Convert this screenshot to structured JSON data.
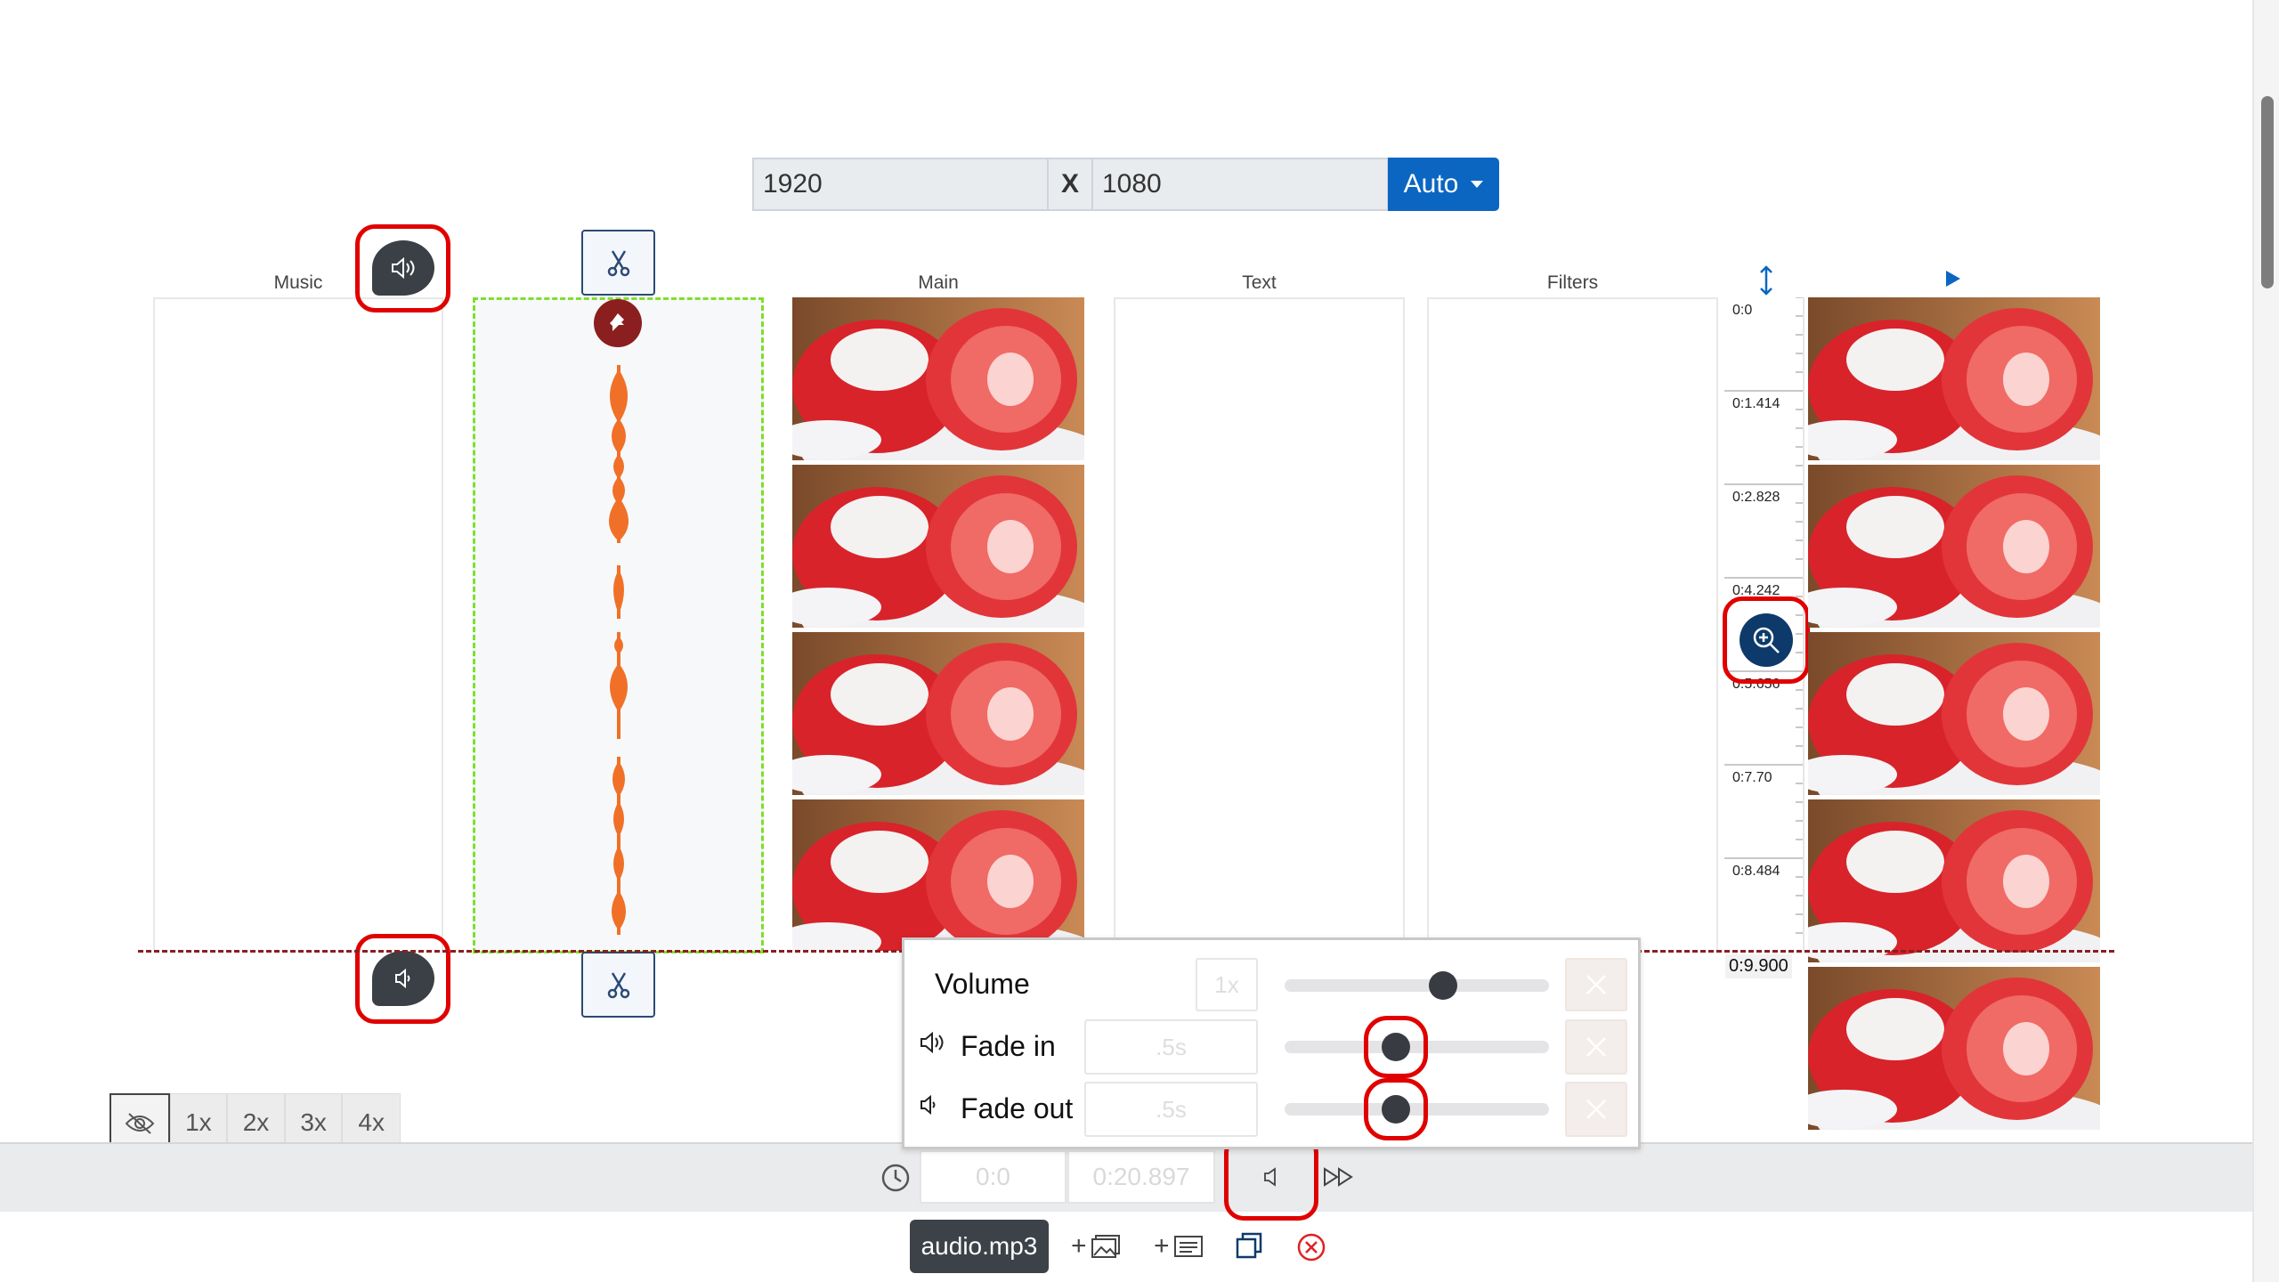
{
  "resolution": {
    "width": "1920",
    "separator": "X",
    "height": "1080",
    "mode_label": "Auto"
  },
  "columns": {
    "music": "Music",
    "main": "Main",
    "text": "Text",
    "filters": "Filters"
  },
  "timeline": {
    "marks": [
      "0:0",
      "0:1.414",
      "0:2.828",
      "0:4.242",
      "0:5.656",
      "0:7.70",
      "0:8.484"
    ],
    "end_label": "0:9.900"
  },
  "popup": {
    "volume_label": "Volume",
    "volume_value": "1x",
    "volume_level": 0.6,
    "fade_in_label": "Fade in",
    "fade_in_value": ".5s",
    "fade_out_label": "Fade out",
    "fade_out_value": ".5s"
  },
  "zoom": {
    "options": [
      "1x",
      "2x",
      "3x",
      "4x"
    ]
  },
  "playback": {
    "start_time": "0:0",
    "end_time": "0:20.897"
  },
  "footer": {
    "file_name": "audio.mp3",
    "add_image_label": "+",
    "add_text_label": "+"
  },
  "colors": {
    "accent": "#0b66c2",
    "highlight": "#e00000",
    "waveform": "#f07028",
    "track_border": "#7ee02a"
  }
}
